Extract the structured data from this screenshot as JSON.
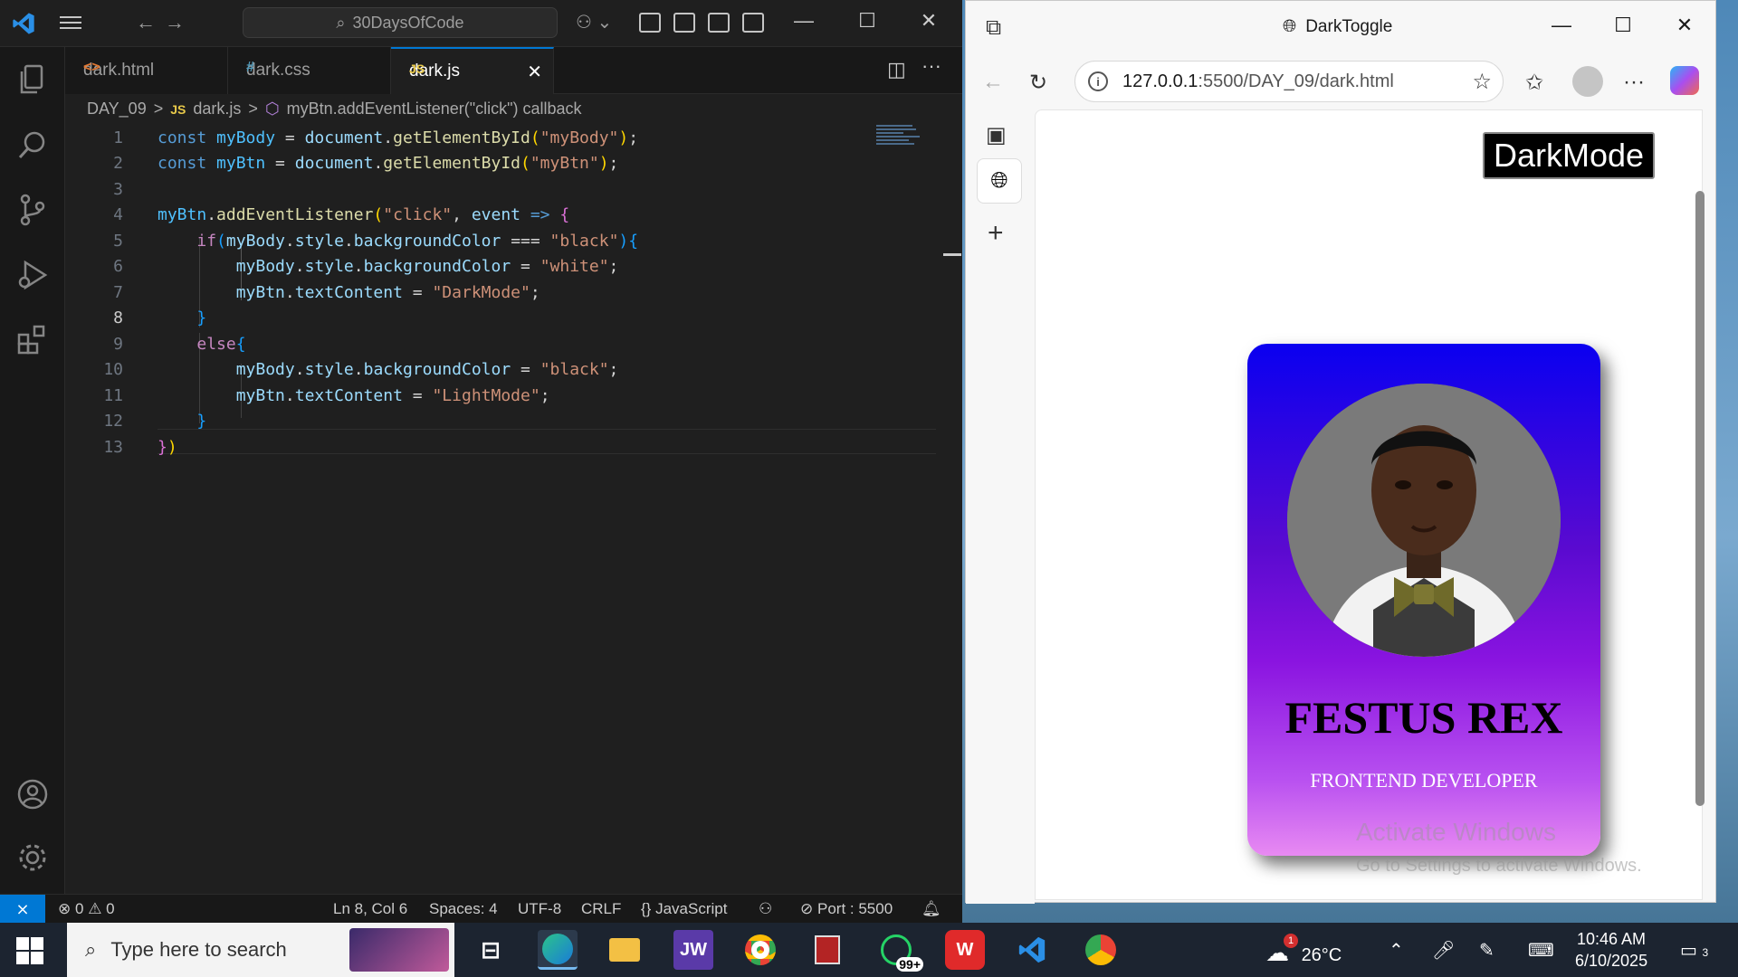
{
  "vscode": {
    "search_text": "30DaysOfCode",
    "tabs": [
      {
        "icon": "<>",
        "label": "dark.html"
      },
      {
        "icon": "#",
        "label": "dark.css"
      },
      {
        "icon": "JS",
        "label": "dark.js"
      }
    ],
    "tab_close": "✕",
    "breadcrumb": {
      "folder": "DAY_09",
      "sep": ">",
      "file_icon": "JS",
      "file": "dark.js",
      "symbol": "myBtn.addEventListener(\"click\") callback"
    },
    "line_numbers": [
      "1",
      "2",
      "3",
      "4",
      "5",
      "6",
      "7",
      "8",
      "9",
      "10",
      "11",
      "12",
      "13"
    ],
    "status": {
      "errors": "0",
      "warnings": "0",
      "position": "Ln 8, Col 6",
      "spaces": "Spaces: 4",
      "encoding": "UTF-8",
      "eol": "CRLF",
      "language_braces": "{}",
      "language": "JavaScript",
      "port": "Port : 5500"
    }
  },
  "edge": {
    "title": "DarkToggle",
    "url_host": "127.0.0.1",
    "url_path": ":5500/DAY_09/dark.html",
    "page": {
      "button_label": "DarkMode",
      "name": "FESTUS REX",
      "role": "FRONTEND DEVELOPER"
    },
    "watermark_line1": "Activate Windows",
    "watermark_line2": "Go to Settings to activate Windows."
  },
  "taskbar": {
    "search_placeholder": "Type here to search",
    "whatsapp_badge": "99+",
    "weather_badge": "1",
    "temperature": "26°C",
    "time": "10:46 AM",
    "date": "6/10/2025",
    "notification_count": "3",
    "jw_label": "JW"
  },
  "colors": {
    "vscode_accent": "#0078d4",
    "card_gradient_top": "#0a00f0",
    "card_gradient_bottom": "#e88af2"
  }
}
